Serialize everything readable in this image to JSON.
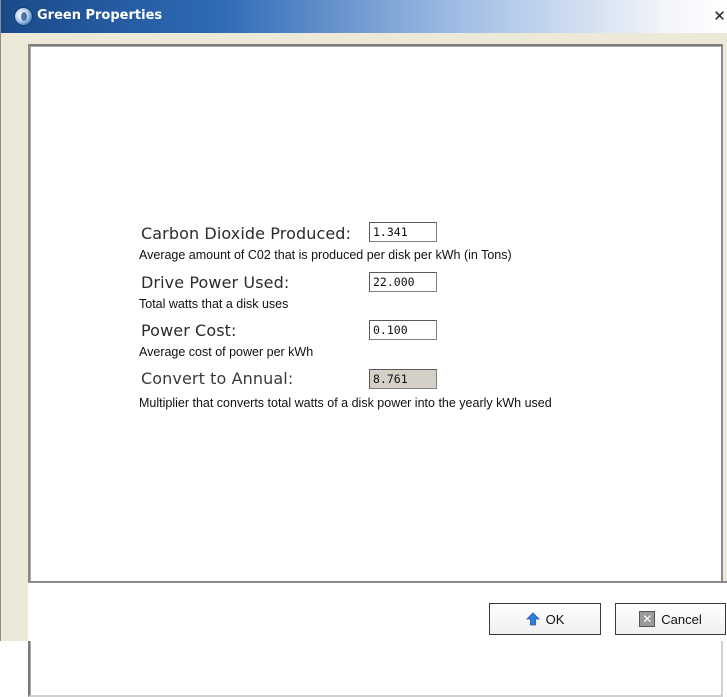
{
  "window": {
    "title": "Green Properties",
    "icon": "app-logo-icon",
    "close_glyph": "✕"
  },
  "fields": [
    {
      "label": "Carbon Dioxide Produced:",
      "value": "1.341",
      "description": "Average amount of C02 that is produced per disk per kWh (in Tons)",
      "editable": true
    },
    {
      "label": "Drive Power Used:",
      "value": "22.000",
      "description": "Total watts that a disk uses",
      "editable": true
    },
    {
      "label": "Power Cost:",
      "value": "0.100",
      "description": "Average cost of power per kWh",
      "editable": true
    },
    {
      "label": "Convert to Annual:",
      "value": "8.761",
      "description": "Multiplier that converts total watts of a disk power into the yearly kWh used",
      "editable": false
    }
  ],
  "buttons": {
    "ok_label": "OK",
    "ok_icon": "up-arrow-icon",
    "cancel_label": "Cancel",
    "cancel_icon": "cancel-x-icon"
  },
  "colors": {
    "title_gradient_start": "#1a4a8a",
    "readonly_field_bg": "#d4d0c8",
    "ok_arrow": "#2f7de0"
  }
}
